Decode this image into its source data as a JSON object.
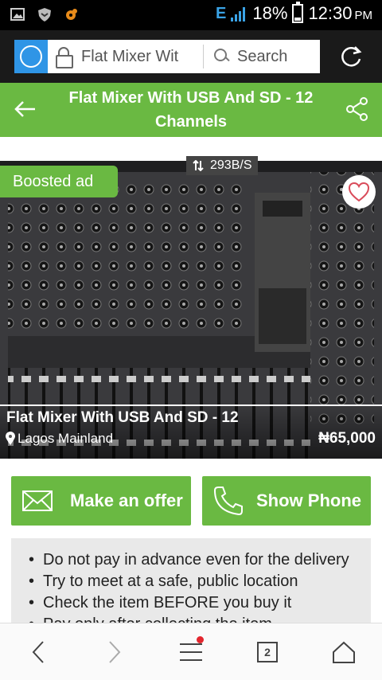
{
  "status_bar": {
    "network": "E",
    "battery": "18%",
    "battery_level": 0.18,
    "time": "12:30",
    "ampm": "PM"
  },
  "browser": {
    "url_text": "Flat Mixer Wit",
    "search_placeholder": "Search"
  },
  "header": {
    "title": "Flat Mixer With USB And SD - 12 Channels"
  },
  "listing": {
    "boosted_label": "Boosted ad",
    "speed": "293B/S",
    "title": "Flat Mixer With USB And SD - 12",
    "location": "Lagos Mainland",
    "price": "₦65,000"
  },
  "actions": {
    "offer_label": "Make an offer",
    "phone_label": "Show Phone"
  },
  "safety_tips": [
    "Do not pay in advance even for the delivery",
    "Try to meet at a safe, public location",
    "Check the item BEFORE you buy it",
    "Pay only after collecting the item"
  ],
  "bottom_nav": {
    "tab_count": "2"
  },
  "colors": {
    "accent_green": "#6ab942",
    "browser_blue": "#2f95e6",
    "notification_red": "#e3262e"
  }
}
